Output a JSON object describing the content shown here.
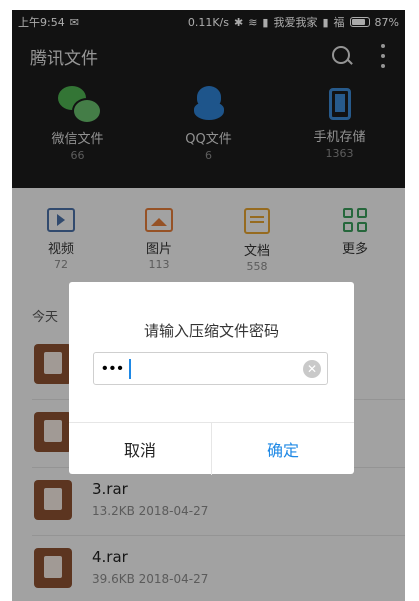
{
  "status_bar": {
    "time": "上午9:54",
    "speed": "0.11K/s",
    "carrier1": "我爱我家",
    "carrier2": "福",
    "battery": "87%"
  },
  "app_bar": {
    "title": "腾讯文件",
    "search_icon": "search-icon",
    "more_icon": "more-vertical-icon"
  },
  "top_items": [
    {
      "label": "微信文件",
      "count": "66",
      "icon": "wechat-icon",
      "color": "#4caf50"
    },
    {
      "label": "QQ文件",
      "count": "6",
      "icon": "qq-icon",
      "color": "#2e7fd0"
    },
    {
      "label": "手机存储",
      "count": "1363",
      "icon": "phone-storage-icon",
      "color": "#3b86d0"
    }
  ],
  "categories": [
    {
      "label": "视频",
      "count": "72",
      "icon": "video-icon"
    },
    {
      "label": "图片",
      "count": "113",
      "icon": "image-icon"
    },
    {
      "label": "文档",
      "count": "558",
      "icon": "document-icon"
    },
    {
      "label": "更多",
      "count": "",
      "icon": "grid-icon"
    }
  ],
  "list": {
    "section_header": "今天",
    "items": [
      {
        "name": "",
        "meta": ""
      },
      {
        "name": "",
        "meta": ""
      },
      {
        "name": "3.rar",
        "meta": "13.2KB   2018-04-27"
      },
      {
        "name": "4.rar",
        "meta": "39.6KB   2018-04-27"
      }
    ]
  },
  "dialog": {
    "title": "请输入压缩文件密码",
    "password_value": "•••",
    "cancel_label": "取消",
    "confirm_label": "确定",
    "accent_color": "#1e88e5"
  }
}
